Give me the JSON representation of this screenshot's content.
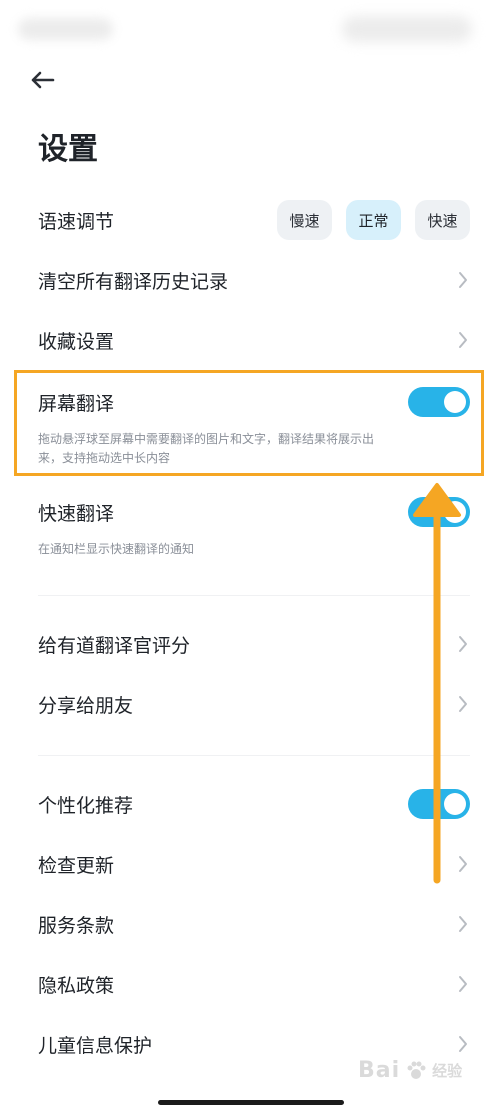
{
  "header": {
    "title": "设置"
  },
  "speech_rate": {
    "label": "语速调节",
    "options": [
      "慢速",
      "正常",
      "快速"
    ],
    "selected": "正常"
  },
  "rows": {
    "clear_history": "清空所有翻译历史记录",
    "favorites": "收藏设置",
    "screen_translate": {
      "label": "屏幕翻译",
      "desc_line1": "拖动悬浮球至屏幕中需要翻译的图片和文字，翻译结果将展示出",
      "desc_line2": "来，支持拖动选中长内容",
      "enabled": true
    },
    "quick_translate": {
      "label": "快速翻译",
      "desc": "在通知栏显示快速翻译的通知",
      "enabled": true
    },
    "rate_app": "给有道翻译官评分",
    "share": "分享给朋友",
    "personalized": {
      "label": "个性化推荐",
      "enabled": true
    },
    "check_update": "检查更新",
    "terms": "服务条款",
    "privacy": "隐私政策",
    "child_protection": "儿童信息保护"
  },
  "watermark": {
    "brand": "Bai",
    "brand_suffix": "经验"
  },
  "colors": {
    "accent": "#28b3e8",
    "highlight": "#f5a623",
    "selected_chip": "#d7f0fb"
  }
}
